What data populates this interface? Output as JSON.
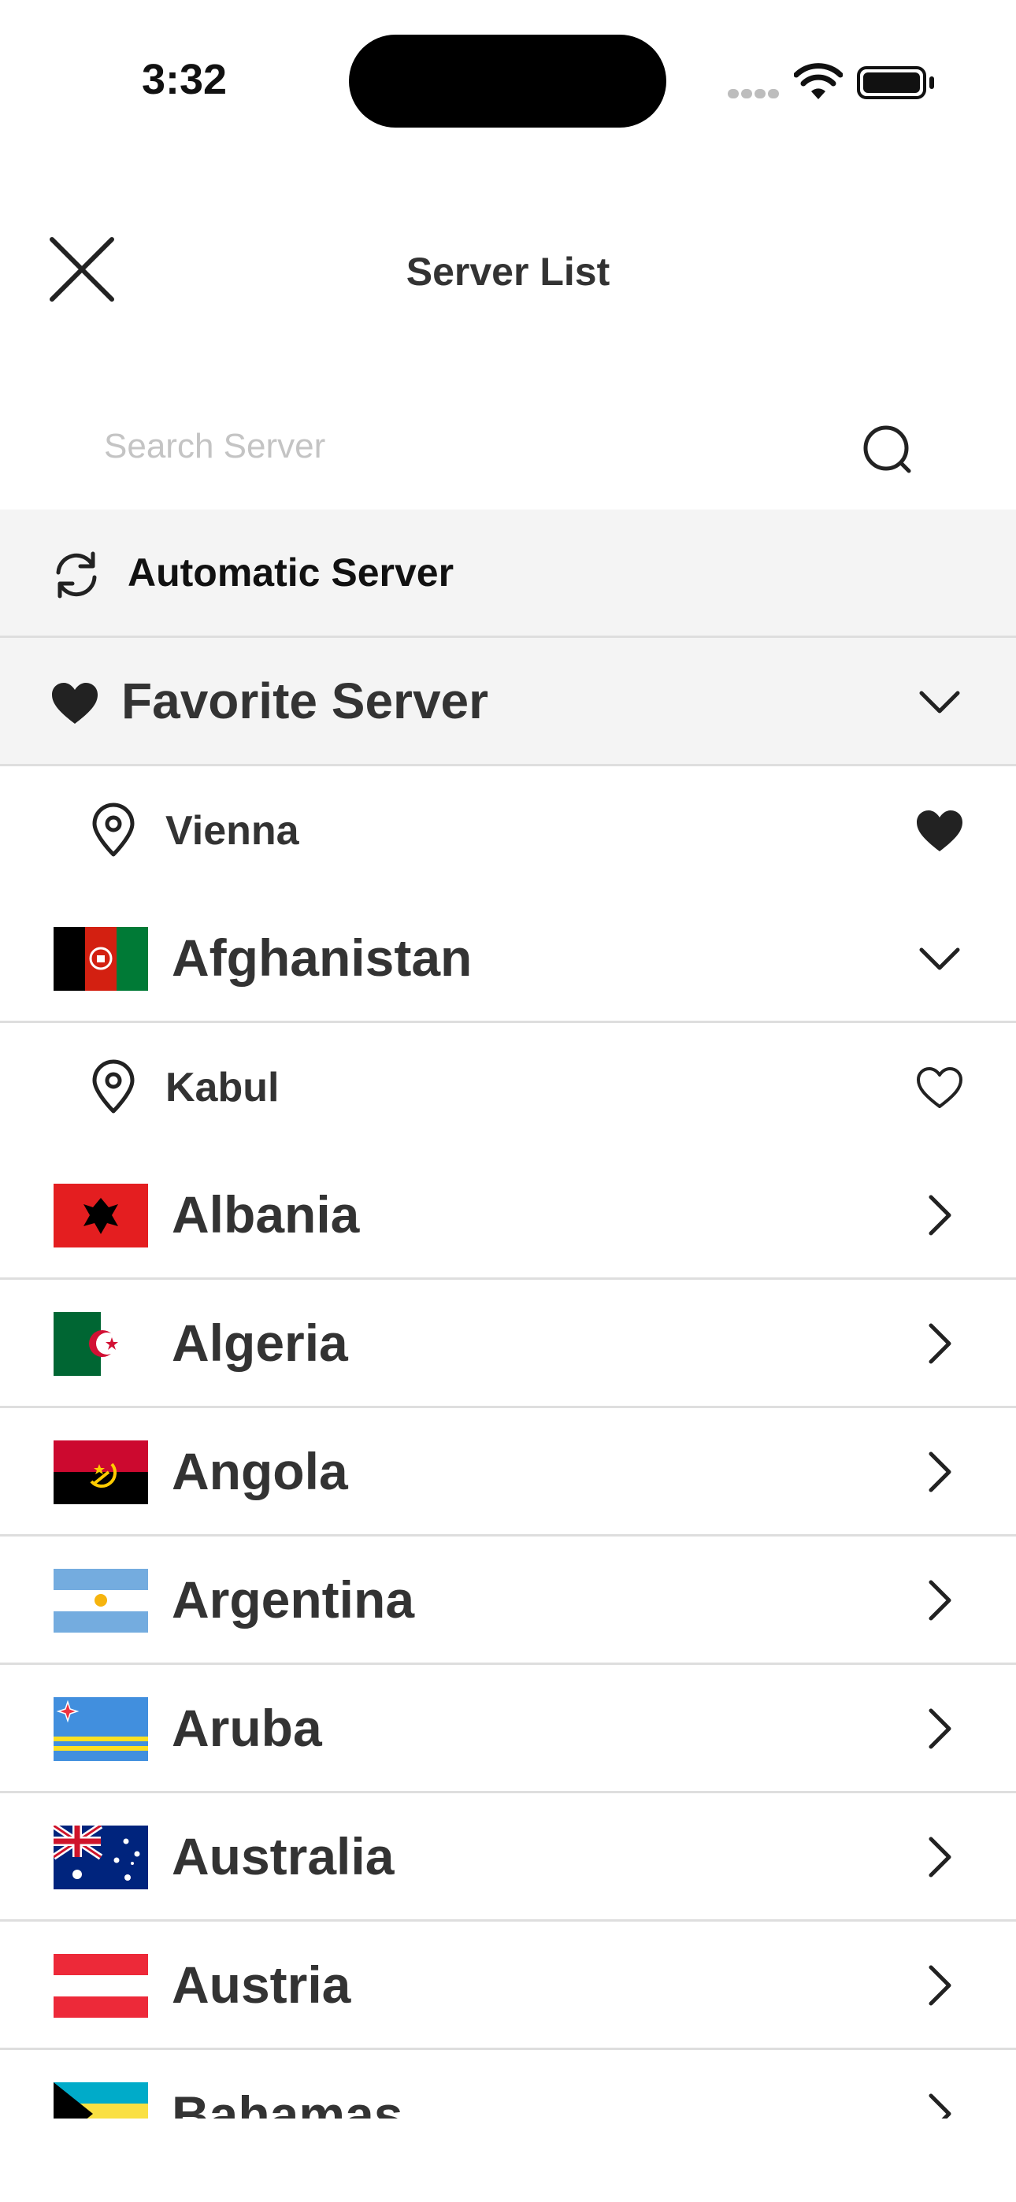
{
  "status_bar": {
    "time": "3:32"
  },
  "header": {
    "title": "Server List"
  },
  "search": {
    "placeholder": "Search Server"
  },
  "automatic": {
    "label": "Automatic Server"
  },
  "favorites": {
    "label": "Favorite Server",
    "items": [
      {
        "city": "Vienna",
        "favorited": true
      }
    ]
  },
  "countries": [
    {
      "name": "Afghanistan",
      "expanded": true,
      "cities": [
        {
          "city": "Kabul",
          "favorited": false
        }
      ]
    },
    {
      "name": "Albania",
      "expanded": false
    },
    {
      "name": "Algeria",
      "expanded": false
    },
    {
      "name": "Angola",
      "expanded": false
    },
    {
      "name": "Argentina",
      "expanded": false
    },
    {
      "name": "Aruba",
      "expanded": false
    },
    {
      "name": "Australia",
      "expanded": false
    },
    {
      "name": "Austria",
      "expanded": false
    },
    {
      "name": "Bahamas",
      "expanded": false
    }
  ],
  "colors": {
    "row_gray": "#f4f4f4",
    "divider": "#dedede",
    "text": "#333333",
    "icon": "#222222"
  }
}
